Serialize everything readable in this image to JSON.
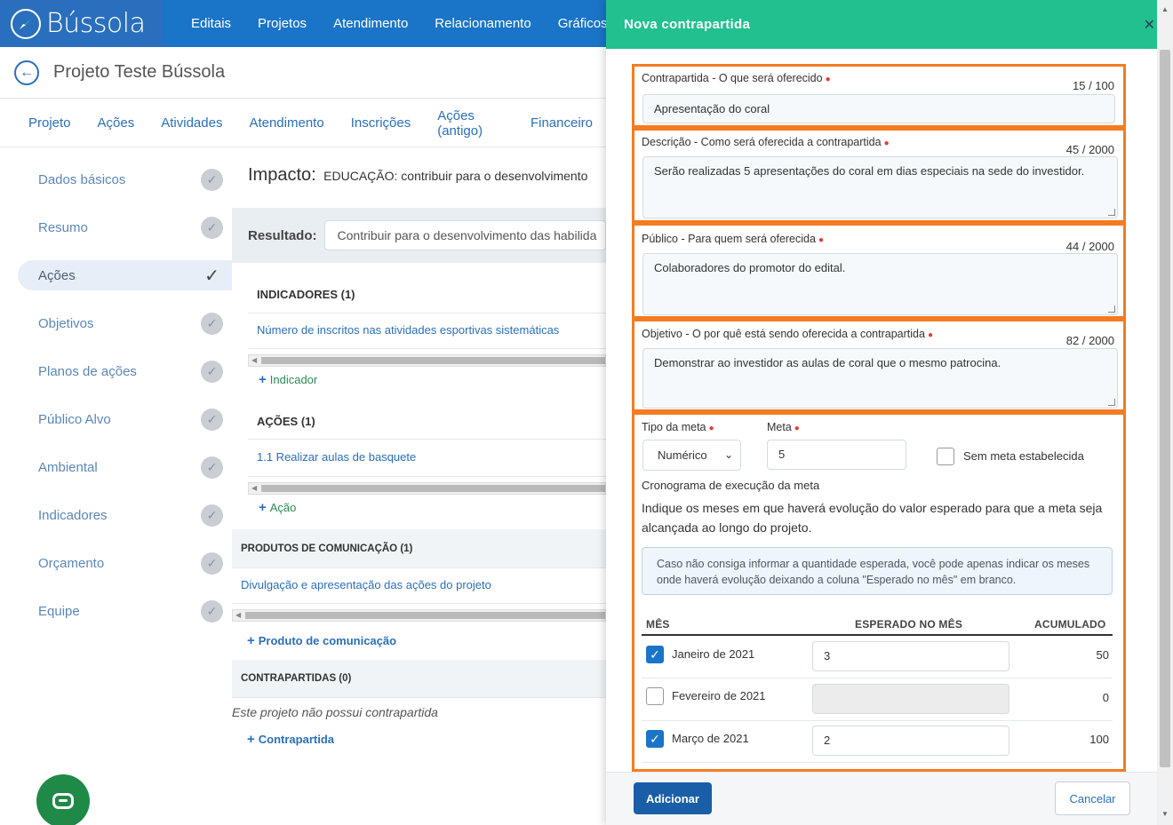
{
  "app": {
    "logo_text": "Bússola",
    "nav": [
      "Editais",
      "Projetos",
      "Atendimento",
      "Relacionamento",
      "Gráficos"
    ]
  },
  "project": {
    "title": "Projeto Teste Bússola",
    "tabs": [
      "Projeto",
      "Ações",
      "Atividades",
      "Atendimento",
      "Inscrições",
      "Ações (antigo)",
      "Financeiro"
    ]
  },
  "sidebar": {
    "items": [
      {
        "label": "Dados básicos"
      },
      {
        "label": "Resumo"
      },
      {
        "label": "Ações",
        "active": true
      },
      {
        "label": "Objetivos"
      },
      {
        "label": "Planos de ações"
      },
      {
        "label": "Público Alvo"
      },
      {
        "label": "Ambiental"
      },
      {
        "label": "Indicadores"
      },
      {
        "label": "Orçamento"
      },
      {
        "label": "Equipe"
      }
    ]
  },
  "main": {
    "impact_label": "Impacto:",
    "impact_value": "EDUCAÇÃO: contribuir para o desenvolvimento",
    "result_label": "Resultado:",
    "result_value": "Contribuir para o desenvolvimento das habilida",
    "indicators_head": "INDICADORES (1)",
    "indicator_item": "Número de inscritos nas atividades esportivas sistemáticas",
    "add_indicator": "Indicador",
    "actions_head": "AÇÕES (1)",
    "action_item": "1.1 Realizar aulas de basquete",
    "add_action": "Ação",
    "products_head": "PRODUTOS DE COMUNICAÇÃO (1)",
    "product_item": "Divulgação e apresentação das ações do projeto",
    "add_product": "Produto de comunicação",
    "counterparts_head": "CONTRAPARTIDAS (0)",
    "counterparts_empty": "Este projeto não possui contrapartida",
    "add_counterpart": "Contrapartida"
  },
  "modal": {
    "title": "Nova contrapartida",
    "fields": {
      "oferecido": {
        "label": "Contrapartida - O que será oferecido",
        "counter": "15 / 100",
        "value": "Apresentação do coral"
      },
      "descricao": {
        "label": "Descrição - Como será oferecida a contrapartida",
        "counter": "45 / 2000",
        "value": "Serão realizadas 5 apresentações do coral em dias especiais na sede do investidor."
      },
      "publico": {
        "label": "Público - Para quem será oferecida",
        "counter": "44 / 2000",
        "value": "Colaboradores do promotor do edital."
      },
      "objetivo": {
        "label": "Objetivo - O por quê está sendo oferecida a contrapartida",
        "counter": "82 / 2000",
        "value": "Demonstrar ao investidor as aulas de coral que o mesmo patrocina."
      }
    },
    "tipo_meta_label": "Tipo da meta",
    "tipo_meta_value": "Numérico",
    "meta_label": "Meta",
    "meta_value": "5",
    "sem_meta_label": "Sem meta estabelecida",
    "cronograma_label": "Cronograma de execução da meta",
    "cronograma_help": "Indique os meses em que haverá evolução do valor esperado para que a meta seja alcançada ao longo do projeto.",
    "info_text": "Caso não consiga informar a quantidade esperada, você pode apenas indicar os meses onde haverá evolução deixando a coluna \"Esperado no mês\" em branco.",
    "table_headers": {
      "mes": "MÊS",
      "esperado": "ESPERADO NO MÊS",
      "acumulado": "ACUMULADO"
    },
    "rows": [
      {
        "checked": true,
        "month": "Janeiro de 2021",
        "expected": "3",
        "accumulated": "50"
      },
      {
        "checked": false,
        "month": "Fevereiro de 2021",
        "expected": "",
        "accumulated": "0"
      },
      {
        "checked": true,
        "month": "Março de 2021",
        "expected": "2",
        "accumulated": "100"
      }
    ],
    "add_button": "Adicionar",
    "cancel_button": "Cancelar"
  },
  "colors": {
    "brand_blue": "#1a74c7",
    "modal_header": "#22c08f",
    "highlight_orange": "#f47c20",
    "primary_button": "#1a5ea8"
  }
}
